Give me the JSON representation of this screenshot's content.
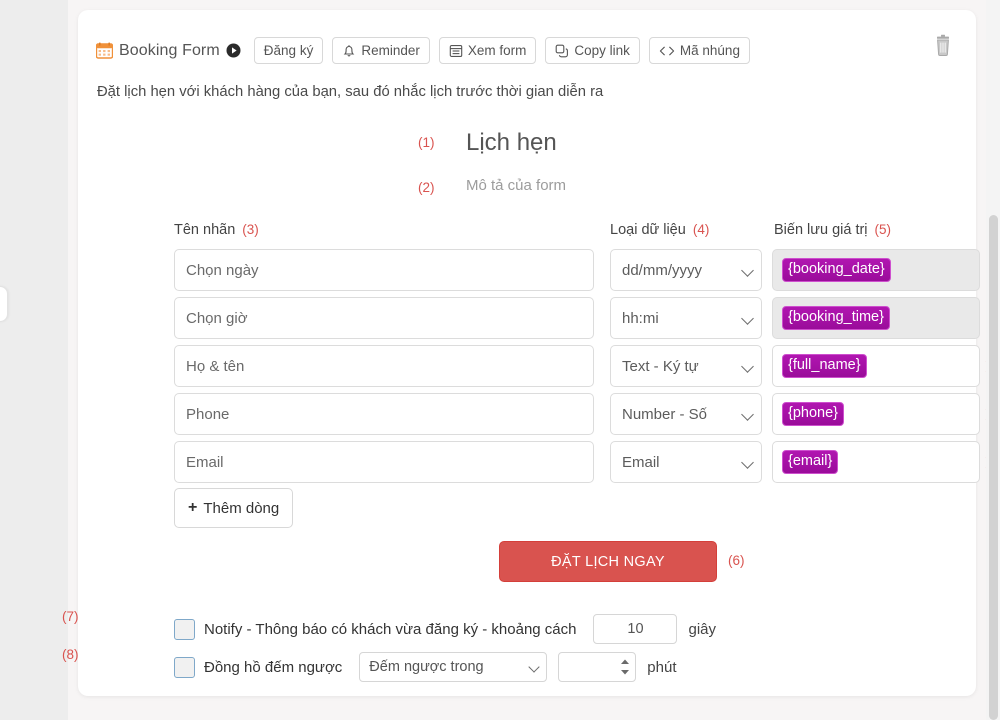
{
  "colors": {
    "accent_red": "#d9534f",
    "marker_red": "#d9534f",
    "token_purple": "#a80fa8",
    "calendar_orange": "#f0913a",
    "page_bg": "#eeeeee",
    "card_bg": "#ffffff"
  },
  "toolbar": {
    "form_title": "Booking Form",
    "calendar_icon": "calendar-icon",
    "play_icon": "play-circle-icon",
    "buttons": [
      {
        "label": "Đăng ký",
        "icon": "none"
      },
      {
        "label": "Reminder",
        "icon": "bell-icon"
      },
      {
        "label": "Xem form",
        "icon": "window-icon"
      },
      {
        "label": "Copy link",
        "icon": "copy-icon"
      },
      {
        "label": "Mã nhúng",
        "icon": "code-icon"
      }
    ],
    "delete_icon": "trash-icon"
  },
  "subtitle": "Đặt lịch hẹn với khách hàng của bạn, sau đó nhắc lịch trước thời gian diễn ra",
  "preview": {
    "marker_1": "(1)",
    "marker_2": "(2)",
    "heading": "Lịch hẹn",
    "description_placeholder": "Mô tả của form"
  },
  "columns": {
    "label_header": "Tên nhãn",
    "label_marker": "(3)",
    "type_header": "Loại dữ liệu",
    "type_marker": "(4)",
    "var_header": "Biến lưu giá trị",
    "var_marker": "(5)"
  },
  "rows": [
    {
      "label": "Chọn ngày",
      "type": "dd/mm/yyyy",
      "variable": "{booking_date}",
      "var_disabled": true,
      "deletable": false
    },
    {
      "label": "Chọn giờ",
      "type": "hh:mi",
      "variable": "{booking_time}",
      "var_disabled": true,
      "deletable": false
    },
    {
      "label": "Họ & tên",
      "type": "Text - Ký tự",
      "variable": "{full_name}",
      "var_disabled": false,
      "deletable": true
    },
    {
      "label": "Phone",
      "type": "Number - Số",
      "variable": "{phone}",
      "var_disabled": false,
      "deletable": true
    },
    {
      "label": "Email",
      "type": "Email",
      "variable": "{email}",
      "var_disabled": false,
      "deletable": true
    }
  ],
  "type_options": [
    "dd/mm/yyyy",
    "hh:mi",
    "Text - Ký tự",
    "Number - Số",
    "Email"
  ],
  "add_row": {
    "label": "Thêm dòng",
    "plus": "+"
  },
  "submit": {
    "label": "ĐẶT LỊCH NGAY",
    "marker": "(6)"
  },
  "options": {
    "notify": {
      "marker": "(7)",
      "label": "Notify - Thông báo có khách vừa đăng ký - khoảng cách",
      "value": "10",
      "unit": "giây",
      "checked": false
    },
    "countdown": {
      "marker": "(8)",
      "label": "Đồng hồ đếm ngược",
      "select_value": "Đếm ngược trong",
      "select_options": [
        "Đếm ngược trong"
      ],
      "value": "",
      "unit": "phút",
      "checked": false
    }
  }
}
